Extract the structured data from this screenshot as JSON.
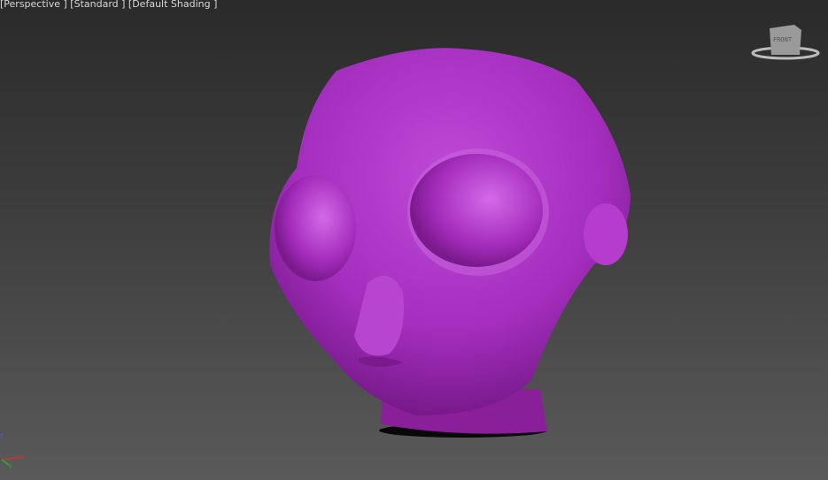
{
  "viewport": {
    "labels": [
      "[Perspective ]",
      "[Standard ]",
      "[Default Shading ]"
    ],
    "view_cube_face": "FRONT",
    "axes": {
      "x": "x",
      "y": "y",
      "z": "z"
    },
    "colors": {
      "model": "#b030c8",
      "background_top": "#2a2a2a",
      "background_bottom": "#5a5a5a"
    }
  }
}
